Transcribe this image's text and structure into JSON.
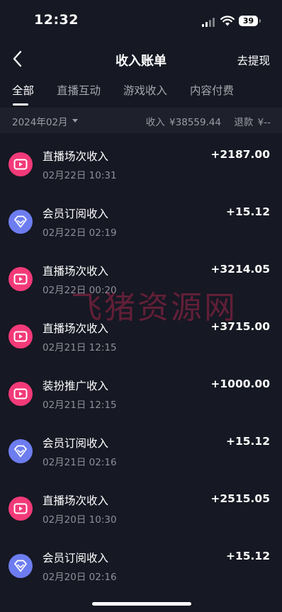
{
  "status_bar": {
    "time": "12:32",
    "battery": "39"
  },
  "header": {
    "title": "收入账单",
    "withdraw_label": "去提现"
  },
  "tabs": [
    {
      "label": "全部",
      "active": true
    },
    {
      "label": "直播互动",
      "active": false
    },
    {
      "label": "游戏收入",
      "active": false
    },
    {
      "label": "内容付费",
      "active": false
    }
  ],
  "filter": {
    "month": "2024年02月",
    "income_label": "收入",
    "income_value": "¥38559.44",
    "refund_label": "退款",
    "refund_value": "¥--"
  },
  "transactions": [
    {
      "title": "直播场次收入",
      "time": "02月22日 10:31",
      "amount": "+2187.00",
      "icon": "live-video-icon"
    },
    {
      "title": "会员订阅收入",
      "time": "02月22日 02:19",
      "amount": "+15.12",
      "icon": "diamond-icon"
    },
    {
      "title": "直播场次收入",
      "time": "02月22日 00:20",
      "amount": "+3214.05",
      "icon": "live-video-icon"
    },
    {
      "title": "直播场次收入",
      "time": "02月21日 12:15",
      "amount": "+3715.00",
      "icon": "live-video-icon"
    },
    {
      "title": "装扮推广收入",
      "time": "02月21日 12:15",
      "amount": "+1000.00",
      "icon": "live-video-icon"
    },
    {
      "title": "会员订阅收入",
      "time": "02月21日 02:16",
      "amount": "+15.12",
      "icon": "diamond-icon"
    },
    {
      "title": "直播场次收入",
      "time": "02月20日 10:30",
      "amount": "+2515.05",
      "icon": "live-video-icon"
    },
    {
      "title": "会员订阅收入",
      "time": "02月20日 02:16",
      "amount": "+15.12",
      "icon": "diamond-icon"
    }
  ],
  "watermark": "飞猪资源网",
  "colors": {
    "background": "#161823",
    "live_icon": "#f23a79",
    "member_icon": "#6d7df0"
  }
}
